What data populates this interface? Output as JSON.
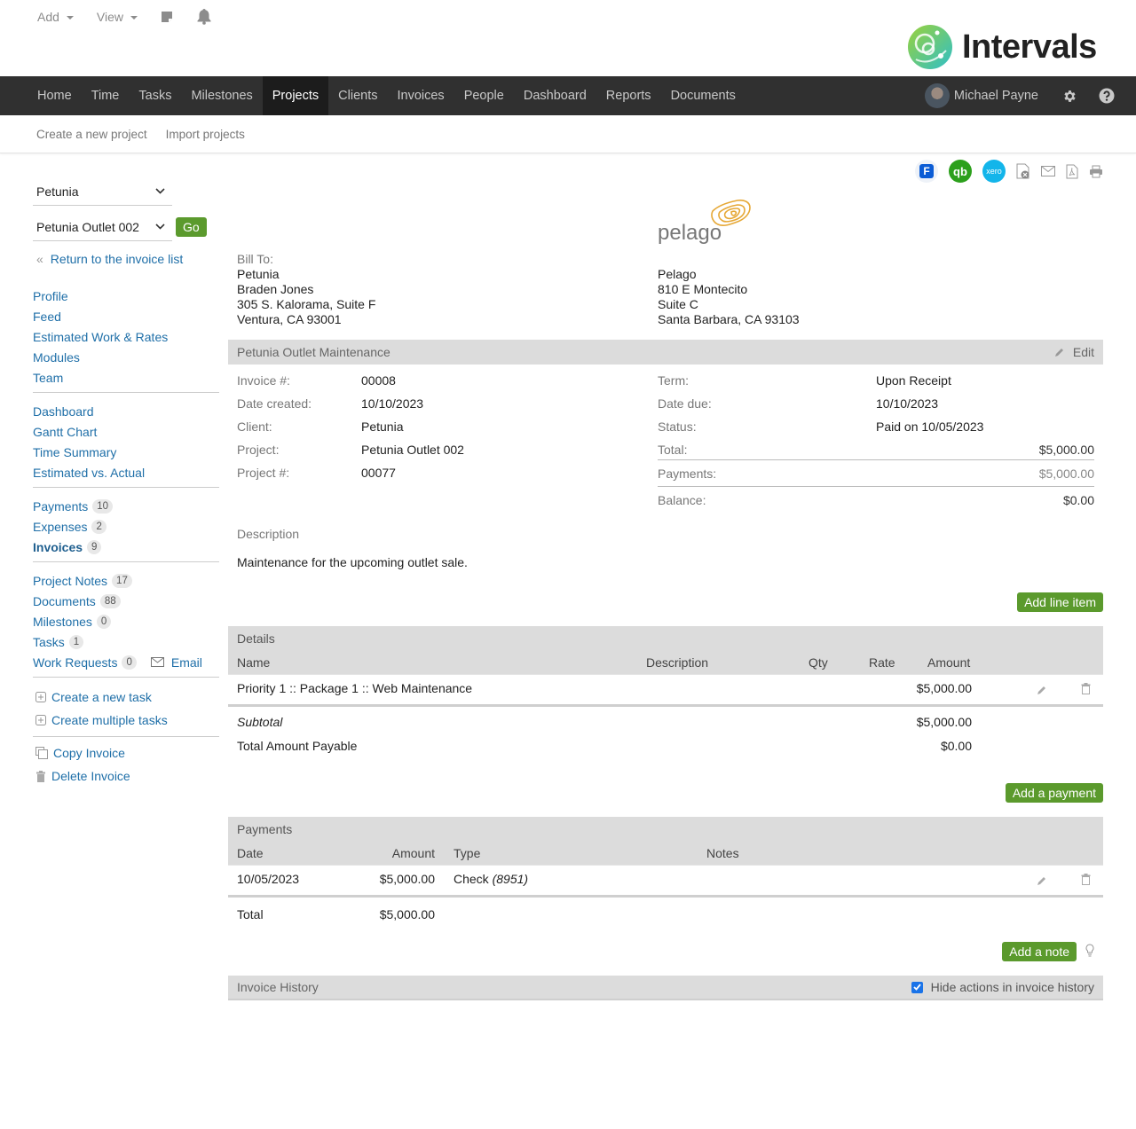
{
  "quick_bar": {
    "add_label": "Add",
    "view_label": "View"
  },
  "brand": {
    "name": "Intervals",
    "accent": "#5b9a2d"
  },
  "main_nav": {
    "items": [
      "Home",
      "Time",
      "Tasks",
      "Milestones",
      "Projects",
      "Clients",
      "Invoices",
      "People",
      "Dashboard",
      "Reports",
      "Documents"
    ],
    "active": "Projects",
    "user_name": "Michael Payne"
  },
  "sub_nav": {
    "items": [
      "Create a new project",
      "Import projects"
    ]
  },
  "sidebar": {
    "client_select": "Petunia",
    "project_select": "Petunia Outlet 002",
    "go_label": "Go",
    "back_link": "Return to the invoice list",
    "group1": [
      "Profile",
      "Feed",
      "Estimated Work & Rates",
      "Modules",
      "Team"
    ],
    "group2": [
      "Dashboard",
      "Gantt Chart",
      "Time Summary",
      "Estimated vs. Actual"
    ],
    "group3": [
      {
        "label": "Payments",
        "count": "10"
      },
      {
        "label": "Expenses",
        "count": "2"
      },
      {
        "label": "Invoices",
        "count": "9",
        "active": true
      }
    ],
    "group4": [
      {
        "label": "Project Notes",
        "count": "17"
      },
      {
        "label": "Documents",
        "count": "88"
      },
      {
        "label": "Milestones",
        "count": "0"
      },
      {
        "label": "Tasks",
        "count": "1"
      },
      {
        "label": "Work Requests",
        "count": "0"
      }
    ],
    "email_label": "Email",
    "task_actions": [
      "Create a new task",
      "Create multiple tasks"
    ],
    "invoice_actions": [
      "Copy Invoice",
      "Delete Invoice"
    ]
  },
  "export_icons": [
    "freshbooks-icon",
    "quickbooks-icon",
    "xero-icon",
    "excel-export-icon",
    "email-icon",
    "pdf-icon",
    "print-icon"
  ],
  "invoice": {
    "company_logo_text": "pelago",
    "bill_to_label": "Bill To:",
    "bill_to": [
      "Petunia",
      "Braden Jones",
      "305 S. Kalorama, Suite F",
      "Ventura, CA 93001"
    ],
    "from": [
      "Pelago",
      "810 E Montecito",
      "Suite C",
      "Santa Barbara, CA 93103"
    ],
    "title": "Petunia Outlet Maintenance",
    "edit_label": "Edit",
    "left_fields": [
      {
        "label": "Invoice #:",
        "value": "00008"
      },
      {
        "label": "Date created:",
        "value": "10/10/2023"
      },
      {
        "label": "Client:",
        "value": "Petunia"
      },
      {
        "label": "Project:",
        "value": "Petunia Outlet 002"
      },
      {
        "label": "Project #:",
        "value": "00077"
      }
    ],
    "right_fields": [
      {
        "label": "Term:",
        "value": "Upon Receipt"
      },
      {
        "label": "Date due:",
        "value": "10/10/2023"
      },
      {
        "label": "Status:",
        "value": "Paid on 10/05/2023"
      }
    ],
    "totals": [
      {
        "label": "Total:",
        "value": "$5,000.00"
      },
      {
        "label": "Payments:",
        "value": "$5,000.00"
      },
      {
        "label": "Balance:",
        "value": "$0.00"
      }
    ],
    "description_label": "Description",
    "description": "Maintenance for the upcoming outlet sale."
  },
  "details": {
    "add_button": "Add line item",
    "caption": "Details",
    "columns": [
      "Name",
      "Description",
      "Qty",
      "Rate",
      "Amount"
    ],
    "rows": [
      {
        "name": "Priority 1 :: Package 1 :: Web Maintenance",
        "description": "",
        "qty": "",
        "rate": "",
        "amount": "$5,000.00"
      }
    ],
    "subtotal_label": "Subtotal",
    "subtotal": "$5,000.00",
    "payable_label": "Total Amount Payable",
    "payable": "$0.00"
  },
  "payments": {
    "add_button": "Add a payment",
    "caption": "Payments",
    "columns": [
      "Date",
      "Amount",
      "Type",
      "Notes"
    ],
    "rows": [
      {
        "date": "10/05/2023",
        "amount": "$5,000.00",
        "type": "Check",
        "ref": "(8951)",
        "notes": ""
      }
    ],
    "total_label": "Total",
    "total": "$5,000.00"
  },
  "notes": {
    "add_button": "Add a note"
  },
  "history": {
    "caption": "Invoice History",
    "hide_actions_label": "Hide actions in invoice history",
    "hide_actions_checked": true
  }
}
